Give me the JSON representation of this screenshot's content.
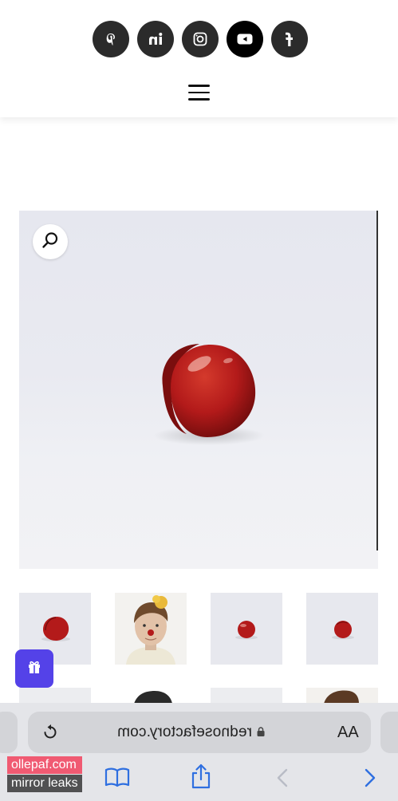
{
  "header": {
    "social_icons": [
      {
        "name": "pinterest-icon"
      },
      {
        "name": "linkedin-icon"
      },
      {
        "name": "instagram-icon"
      },
      {
        "name": "youtube-icon"
      },
      {
        "name": "facebook-icon"
      }
    ],
    "menu_icon": "hamburger-menu-icon"
  },
  "product_gallery": {
    "main_image": "red clown nose on white background",
    "zoom_icon": "magnifier-icon",
    "thumbnail_count": 4
  },
  "gift_button": {
    "icon": "gift-icon",
    "color": "#5442e8"
  },
  "browser": {
    "url": "rednosefactory.com",
    "text_size_label": "AA",
    "reload_icon": "reload-icon",
    "lock_icon": "lock-icon",
    "toolbar": [
      "bookmarks-icon",
      "share-icon",
      "back-icon",
      "forward-icon"
    ]
  },
  "watermark": {
    "line1": "ollepaf.com",
    "line2": "mirror leaks"
  },
  "colors": {
    "header_icon_bg": "#2b2b2b",
    "accent_purple": "#5442e8",
    "nose_red": "#b31a1a",
    "safari_blue": "#2f6fe0"
  }
}
